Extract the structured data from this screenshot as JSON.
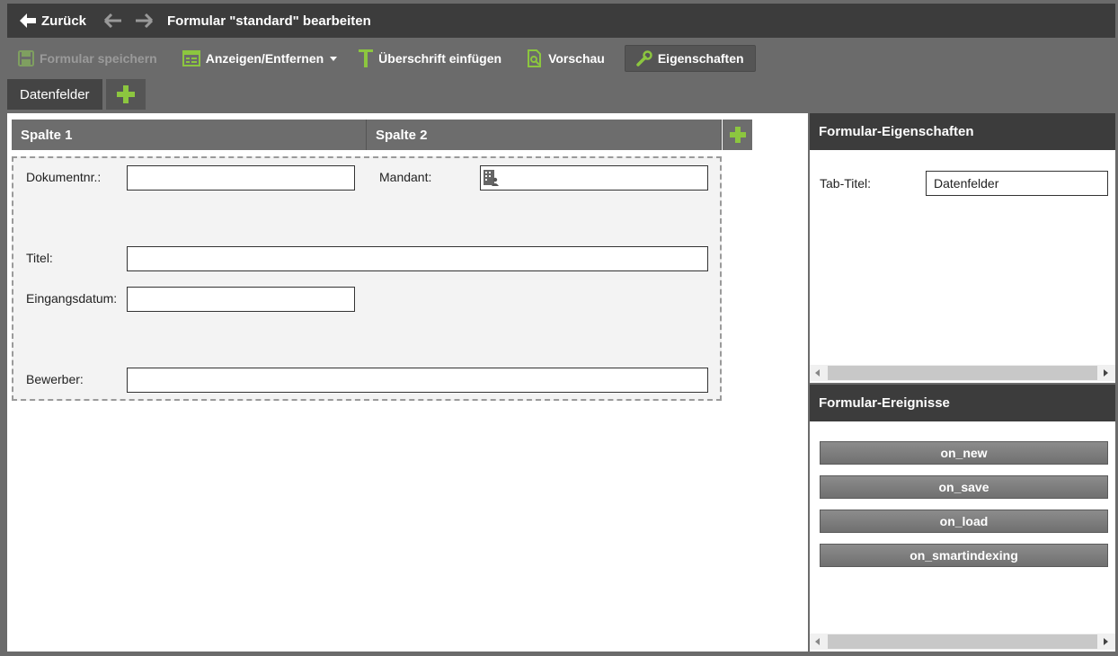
{
  "topbar": {
    "back_label": "Zurück",
    "title": "Formular \"standard\" bearbeiten"
  },
  "toolbar": {
    "save_label": "Formular speichern",
    "show_hide_label": "Anzeigen/Entfernen",
    "heading_label": "Überschrift einfügen",
    "preview_label": "Vorschau",
    "properties_label": "Eigenschaften"
  },
  "tabs": {
    "items": [
      {
        "label": "Datenfelder"
      }
    ]
  },
  "columns": {
    "col1": "Spalte 1",
    "col2": "Spalte 2"
  },
  "form": {
    "fields": {
      "dokumentnr": {
        "label": "Dokumentnr.:",
        "value": ""
      },
      "mandant": {
        "label": "Mandant:",
        "value": ""
      },
      "titel": {
        "label": "Titel:",
        "value": ""
      },
      "eingangsdatum": {
        "label": "Eingangsdatum:",
        "value": ""
      },
      "bewerber": {
        "label": "Bewerber:",
        "value": ""
      }
    }
  },
  "properties_panel": {
    "title": "Formular-Eigenschaften",
    "tab_title_label": "Tab-Titel:",
    "tab_title_value": "Datenfelder"
  },
  "events_panel": {
    "title": "Formular-Ereignisse",
    "buttons": [
      {
        "label": "on_new"
      },
      {
        "label": "on_save"
      },
      {
        "label": "on_load"
      },
      {
        "label": "on_smartindexing"
      }
    ]
  },
  "colors": {
    "accent_green": "#8cc63f",
    "dark_header": "#3c3c3c",
    "toolbar_bg": "#6b6b6b"
  },
  "icons": {
    "back": "arrow-left-icon",
    "nav_back": "arrow-left-icon",
    "nav_forward": "arrow-right-icon",
    "save": "floppy-icon",
    "show_hide": "form-list-icon",
    "heading": "text-t-icon",
    "preview": "document-search-icon",
    "properties": "wrench-icon",
    "add": "plus-icon",
    "mandant": "building-users-icon"
  }
}
